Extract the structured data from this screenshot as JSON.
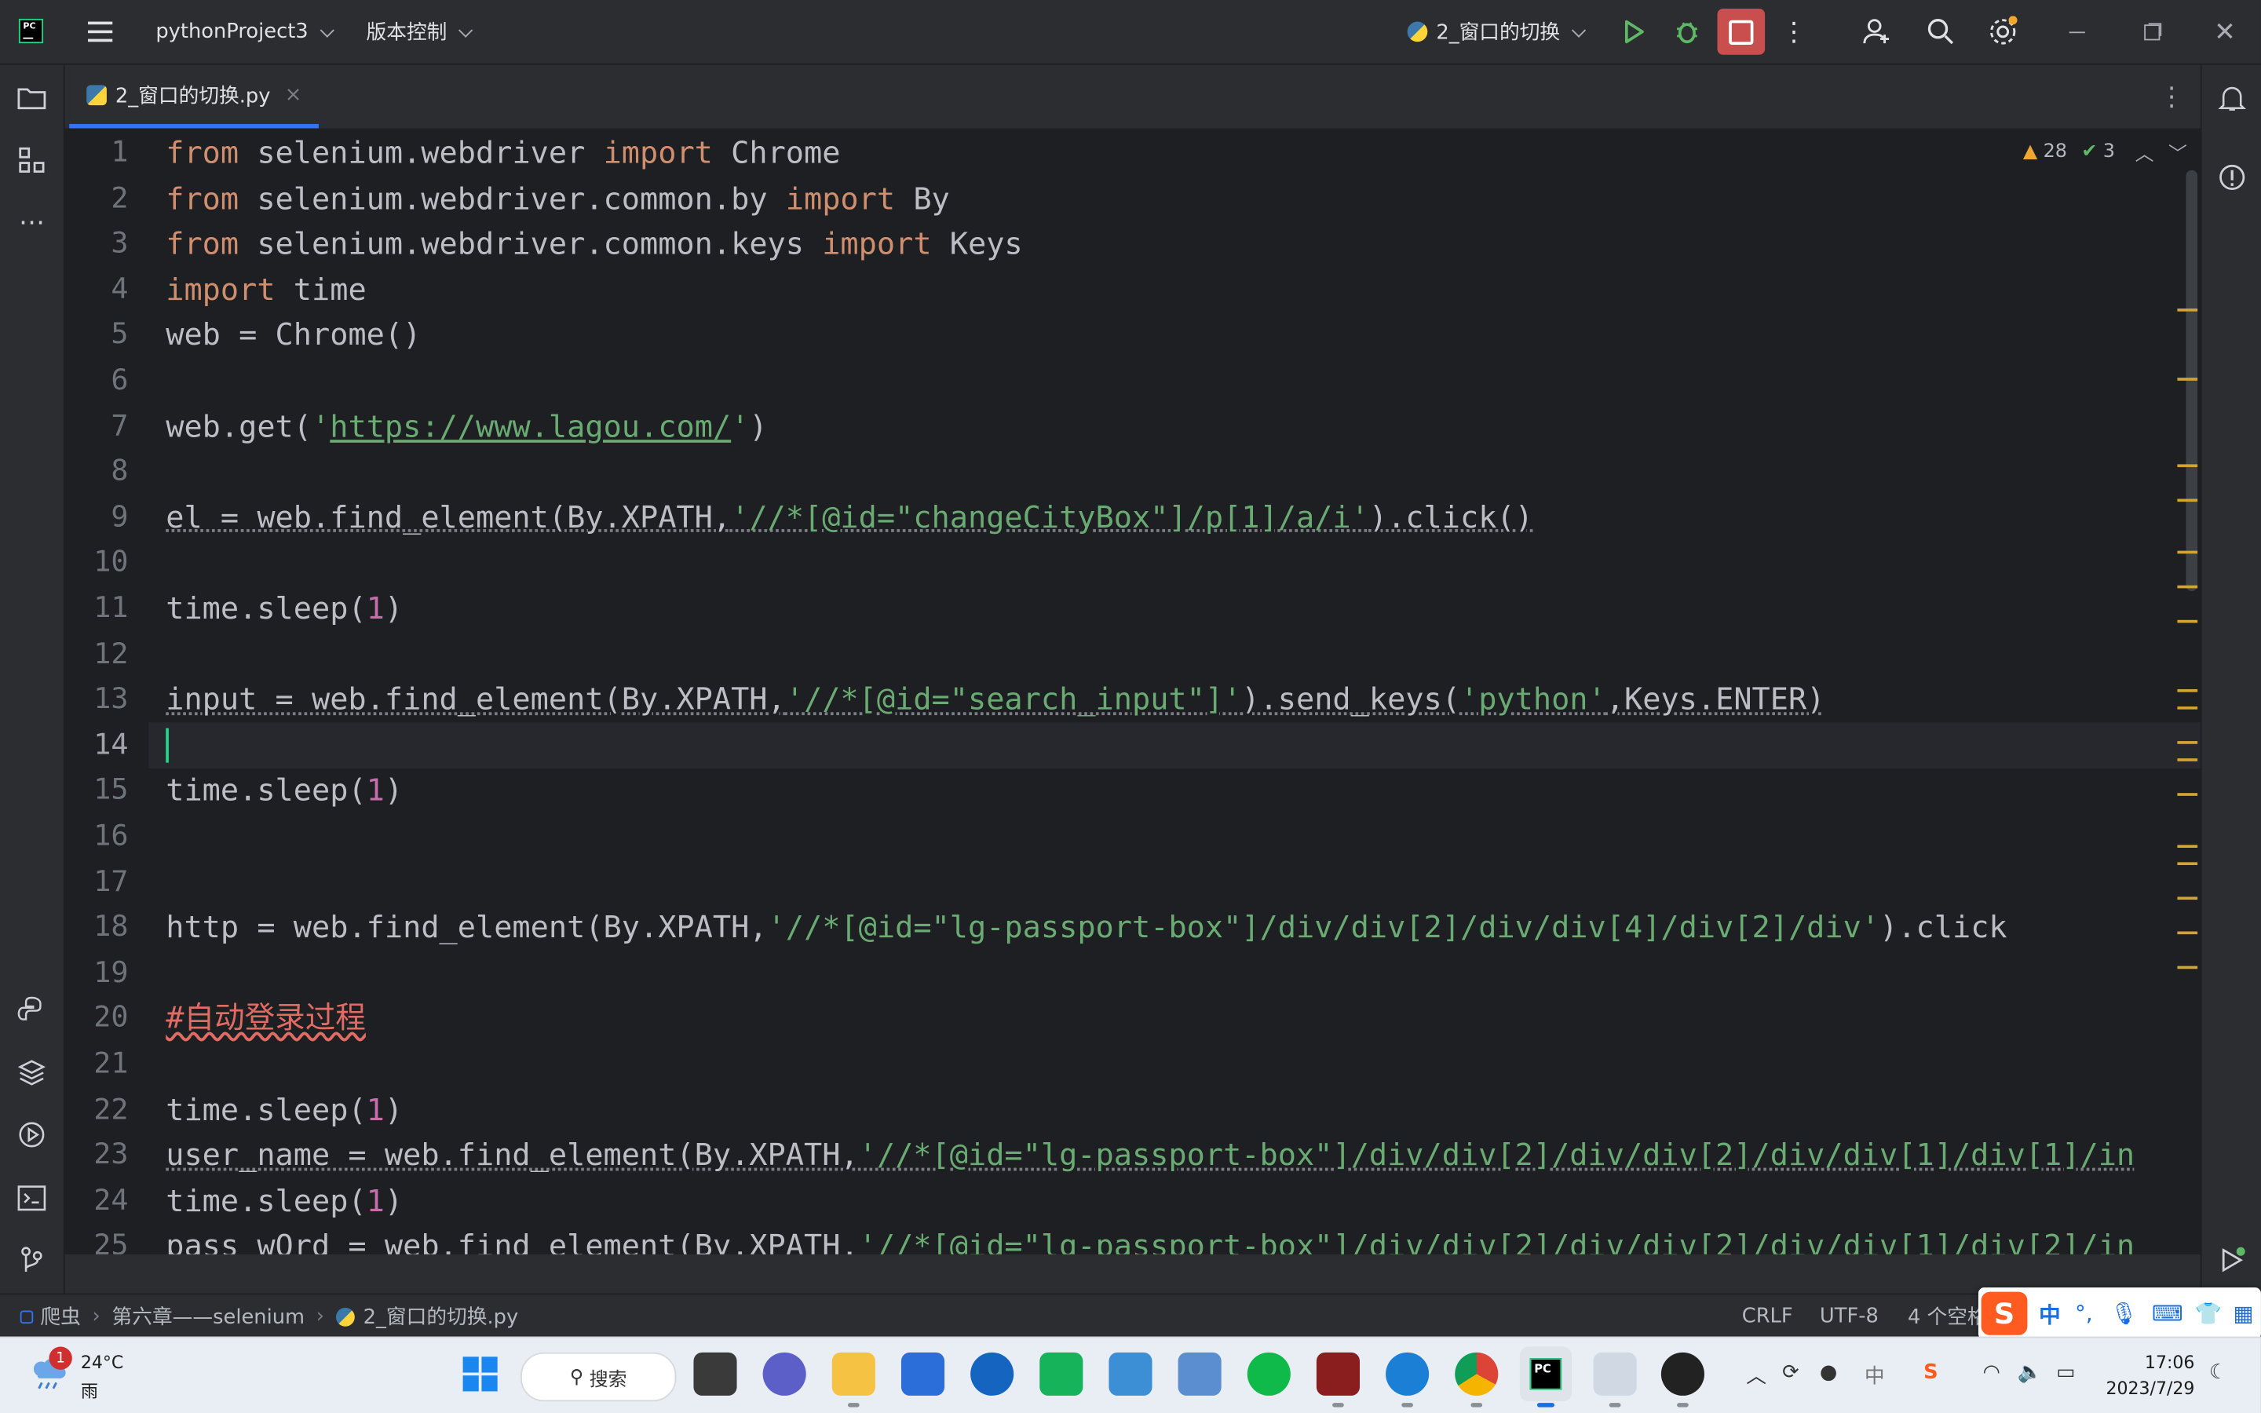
{
  "titlebar": {
    "project": "pythonProject3",
    "vcs": "版本控制",
    "run_config": "2_窗口的切换"
  },
  "tab": {
    "filename": "2_窗口的切换.py",
    "close": "×"
  },
  "inspections": {
    "warnings": "28",
    "checks": "3"
  },
  "editor": {
    "current_line": 14,
    "line_numbers": [
      "1",
      "2",
      "3",
      "4",
      "5",
      "6",
      "7",
      "8",
      "9",
      "10",
      "11",
      "12",
      "13",
      "14",
      "15",
      "16",
      "17",
      "18",
      "19",
      "20",
      "21",
      "22",
      "23",
      "24",
      "25"
    ]
  },
  "code": {
    "l1": {
      "k1": "from",
      "t1": " selenium.webdriver ",
      "k2": "import",
      "t2": " Chrome"
    },
    "l2": {
      "k1": "from",
      "t1": " selenium.webdriver.common.by ",
      "k2": "import",
      "t2": " By"
    },
    "l3": {
      "k1": "from",
      "t1": " selenium.webdriver.common.keys ",
      "k2": "import",
      "t2": " Keys"
    },
    "l4": {
      "k1": "import",
      "t1": " time"
    },
    "l5": {
      "t1": "web = Chrome()"
    },
    "l7": {
      "t1": "web.get(",
      "q1": "'",
      "url": "https://www.lagou.com/",
      "q2": "'",
      "t2": ")"
    },
    "l9": {
      "t1": "el = web.find_element(By.XPATH,",
      "s1": "'//*[@id=\"changeCityBox\"]/p[1]/a/i'",
      "t2": ").click()"
    },
    "l11": {
      "t1": "time.sleep(",
      "n1": "1",
      "t2": ")"
    },
    "l13": {
      "t1": "input = web.find_element(By.XPATH,",
      "s1": "'//*[@id=\"search_input\"]'",
      "t2": ").send_keys(",
      "s2": "'python'",
      "t3": ",Keys.ENTER)"
    },
    "l15": {
      "t1": "time.sleep(",
      "n1": "1",
      "t2": ")"
    },
    "l18": {
      "t1": "http = web.find_element(By.XPATH,",
      "s1": "'//*[@id=\"lg-passport-box\"]/div/div[2]/div/div[4]/div[2]/div'",
      "t2": ").click"
    },
    "l20": {
      "c1": "#自动登录过程"
    },
    "l22": {
      "t1": "time.sleep(",
      "n1": "1",
      "t2": ")"
    },
    "l23": {
      "t1": "user_name = web.find_element(By.XPATH,",
      "s1": "'//*[@id=\"lg-passport-box\"]/div/div[2]/div/div[2]/div/div[1]/div[1]/in"
    },
    "l24": {
      "t1": "time.sleep(",
      "n1": "1",
      "t2": ")"
    },
    "l25": {
      "t1": "pass_wOrd = web.find_element(By.XPATH,",
      "s1": "'//*[@id=\"lg-passport-box\"]/div/div[2]/div/div[2]/div/div[1]/div[2]/in"
    }
  },
  "statusbar": {
    "crumb1": "爬虫",
    "crumb2": "第六章——selenium",
    "crumb3": "2_窗口的切换.py",
    "line_sep": "CRLF",
    "encoding": "UTF-8",
    "indent": "4 个空格"
  },
  "ime": {
    "lang": "中",
    "punct": "°,"
  },
  "taskbar": {
    "weather_temp": "24°C",
    "weather_desc": "雨",
    "weather_badge": "1",
    "search": "搜索",
    "tray_ime": "中",
    "time": "17:06",
    "date": "2023/7/29"
  },
  "colors": {
    "accent": "#3574f0",
    "keyword": "#cf8e6d",
    "string": "#6aab73",
    "number": "#c46fa9",
    "comment_error": "#e06c63",
    "stop_button": "#c94f4f"
  }
}
